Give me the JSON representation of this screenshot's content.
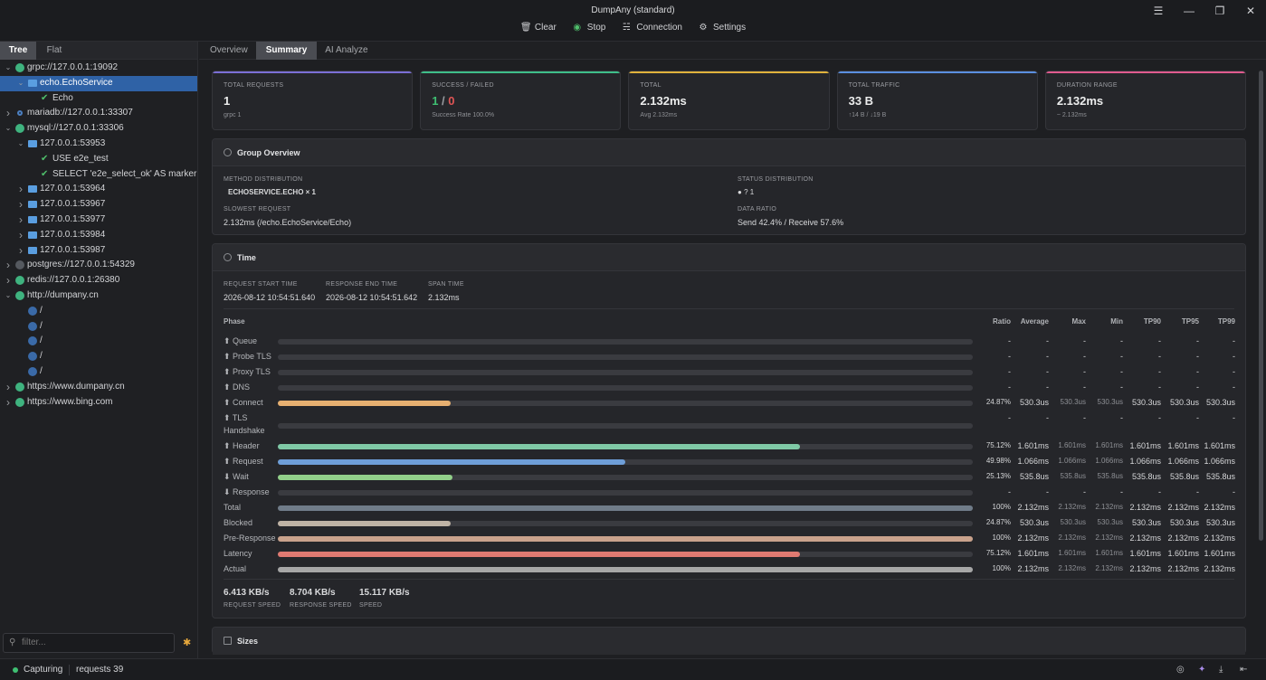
{
  "app": {
    "title": "DumpAny (standard)"
  },
  "toolbar": {
    "clear": "Clear",
    "stop": "Stop",
    "connection": "Connection",
    "settings": "Settings"
  },
  "sidebar": {
    "tabs": [
      "Tree",
      "Flat"
    ],
    "tree": [
      {
        "label": "grpc://127.0.0.1:19092",
        "level": 0,
        "arrow": "down",
        "icon": "dot-green"
      },
      {
        "label": "echo.EchoService",
        "level": 1,
        "arrow": "down",
        "icon": "folder-open",
        "selected": true
      },
      {
        "label": "Echo",
        "level": 2,
        "arrow": "",
        "icon": "check"
      },
      {
        "label": "mariadb://127.0.0.1:33307",
        "level": 0,
        "arrow": "right",
        "icon": "dot-dark"
      },
      {
        "label": "mysql://127.0.0.1:33306",
        "level": 0,
        "arrow": "down",
        "icon": "dot-green"
      },
      {
        "label": "127.0.0.1:53953",
        "level": 1,
        "arrow": "down",
        "icon": "folder-open"
      },
      {
        "label": "USE e2e_test",
        "level": 2,
        "arrow": "",
        "icon": "check"
      },
      {
        "label": "SELECT 'e2e_select_ok' AS marker",
        "level": 2,
        "arrow": "",
        "icon": "check"
      },
      {
        "label": "127.0.0.1:53964",
        "level": 1,
        "arrow": "right",
        "icon": "folder"
      },
      {
        "label": "127.0.0.1:53967",
        "level": 1,
        "arrow": "right",
        "icon": "folder"
      },
      {
        "label": "127.0.0.1:53977",
        "level": 1,
        "arrow": "right",
        "icon": "folder"
      },
      {
        "label": "127.0.0.1:53984",
        "level": 1,
        "arrow": "right",
        "icon": "folder"
      },
      {
        "label": "127.0.0.1:53987",
        "level": 1,
        "arrow": "right",
        "icon": "folder"
      },
      {
        "label": "postgres://127.0.0.1:54329",
        "level": 0,
        "arrow": "right",
        "icon": "dot-grey"
      },
      {
        "label": "redis://127.0.0.1:26380",
        "level": 0,
        "arrow": "right",
        "icon": "dot-green"
      },
      {
        "label": "http://dumpany.cn",
        "level": 0,
        "arrow": "down",
        "icon": "dot-green"
      },
      {
        "label": "/",
        "level": 1,
        "arrow": "",
        "icon": "dot-blue"
      },
      {
        "label": "/",
        "level": 1,
        "arrow": "",
        "icon": "dot-blue"
      },
      {
        "label": "/",
        "level": 1,
        "arrow": "",
        "icon": "dot-blue"
      },
      {
        "label": "/",
        "level": 1,
        "arrow": "",
        "icon": "dot-blue"
      },
      {
        "label": "/",
        "level": 1,
        "arrow": "",
        "icon": "dot-blue"
      },
      {
        "label": "https://www.dumpany.cn",
        "level": 0,
        "arrow": "right",
        "icon": "dot-green"
      },
      {
        "label": "https://www.bing.com",
        "level": 0,
        "arrow": "right",
        "icon": "dot-green"
      }
    ],
    "filter_placeholder": "filter..."
  },
  "main_tabs": [
    "Overview",
    "Summary",
    "AI Analyze"
  ],
  "cards": [
    {
      "label": "TOTAL REQUESTS",
      "value": "1",
      "sub": "grpc 1",
      "color": "#7b6fd6"
    },
    {
      "label": "SUCCESS / FAILED",
      "ok": "1",
      "sep": " / ",
      "fail": "0",
      "sub": "Success Rate 100.0%",
      "color": "#3fbf8a"
    },
    {
      "label": "TOTAL",
      "value": "2.132ms",
      "sub": "Avg 2.132ms",
      "color": "#e0b23c"
    },
    {
      "label": "TOTAL TRAFFIC",
      "value": "33 B",
      "sub": "↑14 B / ↓19 B",
      "color": "#5b8fe0"
    },
    {
      "label": "DURATION RANGE",
      "value": "2.132ms",
      "sub": "~ 2.132ms",
      "color": "#e05b8f"
    }
  ],
  "group": {
    "title": "Group Overview",
    "method_label": "METHOD DISTRIBUTION",
    "method_value": "ECHOSERVICE.ECHO × 1",
    "status_label": "STATUS DISTRIBUTION",
    "status_value": "? 1",
    "slowest_label": "SLOWEST REQUEST",
    "slowest_value": "2.132ms (/echo.EchoService/Echo)",
    "ratio_label": "DATA RATIO",
    "ratio_value": "Send 42.4% / Receive 57.6%"
  },
  "time": {
    "title": "Time",
    "start_label": "REQUEST START TIME",
    "start_value": "2026-08-12 10:54:51.640",
    "end_label": "RESPONSE END TIME",
    "end_value": "2026-08-12 10:54:51.642",
    "span_label": "SPAN TIME",
    "span_value": "2.132ms",
    "columns": [
      "Phase",
      "Ratio",
      "Average",
      "Max",
      "Min",
      "TP90",
      "TP95",
      "TP99"
    ],
    "phases": [
      {
        "name": "⬆ Queue",
        "fill": 0,
        "color": "",
        "ratio": "-",
        "avg": "-",
        "max": "-",
        "min": "-",
        "tp90": "-",
        "tp95": "-",
        "tp99": "-"
      },
      {
        "name": "⬆ Probe TLS",
        "fill": 0,
        "color": "",
        "ratio": "-",
        "avg": "-",
        "max": "-",
        "min": "-",
        "tp90": "-",
        "tp95": "-",
        "tp99": "-"
      },
      {
        "name": "⬆ Proxy TLS",
        "fill": 0,
        "color": "",
        "ratio": "-",
        "avg": "-",
        "max": "-",
        "min": "-",
        "tp90": "-",
        "tp95": "-",
        "tp99": "-"
      },
      {
        "name": "⬆ DNS",
        "fill": 0,
        "color": "",
        "ratio": "-",
        "avg": "-",
        "max": "-",
        "min": "-",
        "tp90": "-",
        "tp95": "-",
        "tp99": "-"
      },
      {
        "name": "⬆ Connect",
        "fill": 0.2487,
        "color": "#e7b071",
        "ratio": "24.87%",
        "avg": "530.3us",
        "max": "530.3us",
        "min": "530.3us",
        "tp90": "530.3us",
        "tp95": "530.3us",
        "tp99": "530.3us"
      },
      {
        "name": "⬆ TLS",
        "name2": "Handshake",
        "fill": 0,
        "color": "",
        "ratio": "-",
        "avg": "-",
        "max": "-",
        "min": "-",
        "tp90": "-",
        "tp95": "-",
        "tp99": "-"
      },
      {
        "name": "⬆ Header",
        "fill": 0.7512,
        "color": "#7fc9a6",
        "ratio": "75.12%",
        "avg": "1.601ms",
        "max": "1.601ms",
        "min": "1.601ms",
        "tp90": "1.601ms",
        "tp95": "1.601ms",
        "tp99": "1.601ms"
      },
      {
        "name": "⬆ Request",
        "fill": 0.4998,
        "color": "#6e9ed8",
        "ratio": "49.98%",
        "avg": "1.066ms",
        "max": "1.066ms",
        "min": "1.066ms",
        "tp90": "1.066ms",
        "tp95": "1.066ms",
        "tp99": "1.066ms"
      },
      {
        "name": "⬇ Wait",
        "fill": 0.2513,
        "color": "#92d08a",
        "ratio": "25.13%",
        "avg": "535.8us",
        "max": "535.8us",
        "min": "535.8us",
        "tp90": "535.8us",
        "tp95": "535.8us",
        "tp99": "535.8us"
      },
      {
        "name": "⬇ Response",
        "fill": 0,
        "color": "",
        "ratio": "-",
        "avg": "-",
        "max": "-",
        "min": "-",
        "tp90": "-",
        "tp95": "-",
        "tp99": "-"
      },
      {
        "name": "Total",
        "fill": 1,
        "color": "#707c89",
        "ratio": "100%",
        "avg": "2.132ms",
        "max": "2.132ms",
        "min": "2.132ms",
        "tp90": "2.132ms",
        "tp95": "2.132ms",
        "tp99": "2.132ms"
      },
      {
        "name": "Blocked",
        "fill": 0.2487,
        "color": "#bfb3a5",
        "ratio": "24.87%",
        "avg": "530.3us",
        "max": "530.3us",
        "min": "530.3us",
        "tp90": "530.3us",
        "tp95": "530.3us",
        "tp99": "530.3us"
      },
      {
        "name": "Pre-Response",
        "fill": 1,
        "color": "#c9a28c",
        "ratio": "100%",
        "avg": "2.132ms",
        "max": "2.132ms",
        "min": "2.132ms",
        "tp90": "2.132ms",
        "tp95": "2.132ms",
        "tp99": "2.132ms"
      },
      {
        "name": "Latency",
        "fill": 0.7512,
        "color": "#e07a72",
        "ratio": "75.12%",
        "avg": "1.601ms",
        "max": "1.601ms",
        "min": "1.601ms",
        "tp90": "1.601ms",
        "tp95": "1.601ms",
        "tp99": "1.601ms"
      },
      {
        "name": "Actual",
        "fill": 1,
        "color": "#a7a7a7",
        "ratio": "100%",
        "avg": "2.132ms",
        "max": "2.132ms",
        "min": "2.132ms",
        "tp90": "2.132ms",
        "tp95": "2.132ms",
        "tp99": "2.132ms"
      }
    ],
    "speeds": [
      {
        "value": "6.413 KB/s",
        "label": "REQUEST SPEED"
      },
      {
        "value": "8.704 KB/s",
        "label": "RESPONSE SPEED"
      },
      {
        "value": "15.117 KB/s",
        "label": "SPEED"
      }
    ]
  },
  "sizes": {
    "title": "Sizes"
  },
  "status": {
    "capturing": "Capturing",
    "requests": "requests 39"
  },
  "colors": {
    "accent": "#2f62a6",
    "success": "#3fbf72",
    "fail": "#e05555"
  }
}
